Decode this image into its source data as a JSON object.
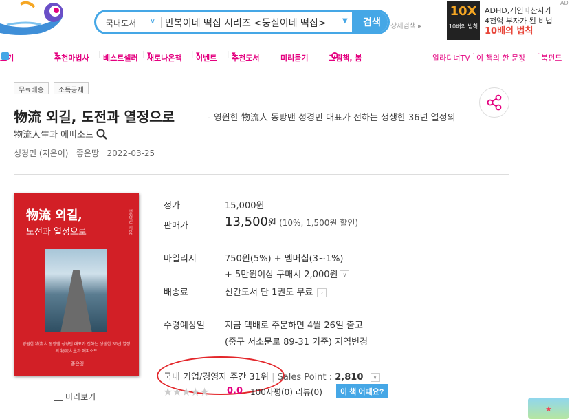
{
  "header": {
    "search": {
      "category": "국내도서",
      "query": "만복이네 떡집 시리즈 <둥실이네 떡집>",
      "button_label": "검색",
      "advanced_label": "상세검색"
    },
    "ad": {
      "mark": "AD",
      "image_title": "10X",
      "image_caption": "10배의 법칙",
      "line1": "ADHD,개인파산자가",
      "line2": "4천억 부자가 된 비법",
      "line3": "10배의 법칙"
    }
  },
  "nav": {
    "items": [
      "보기",
      "추천마법사",
      "베스트셀러",
      "새로나온책",
      "이벤트",
      "추천도서",
      "미리듣기",
      "그림책, 봄"
    ],
    "right": [
      "알라디너TV",
      "이 책의 한 문장",
      "북펀드"
    ]
  },
  "tags": [
    "무료배송",
    "소득공제"
  ],
  "book": {
    "title": "物流 외길, 도전과 열정으로",
    "subtitle": "- 영원한 物流人 동방맨 성경민 대표가 전하는 생생한 36년 열정의",
    "subtitle2": "物流人生과 에피소드",
    "author": "성경민 (지은이)",
    "publisher": "좋은땅",
    "date": "2022-03-25",
    "cover": {
      "title": "物流 외길,",
      "subtitle": "도전과 열정으로",
      "author": "성경민 지음",
      "desc": "영원한 物流人 동방맨 성경민 대표가 전하는 생생한 36년 열정의 物流人生과 에피소드",
      "publisher": "좋은땅"
    },
    "preview_label": "미리보기"
  },
  "info": {
    "list_price_label": "정가",
    "list_price": "15,000원",
    "sale_price_label": "판매가",
    "sale_price": "13,500",
    "sale_unit": "원",
    "sale_discount": "(10%, 1,500원 할인)",
    "mileage_label": "마일리지",
    "mileage_line1": "750원(5%) + 멤버십(3~1%)",
    "mileage_line2": "+ 5만원이상 구매시 2,000원",
    "shipping_label": "배송료",
    "shipping": "신간도서 단 1권도 무료",
    "delivery_label": "수령예상일",
    "delivery_line1": "지금 택배로 주문하면 4월 26일 출고",
    "delivery_line2": "(중구 서소문로 89-31 기준) 지역변경",
    "rank": "국내 기업/경영자 주간 31위",
    "sales_point_label": "Sales Point :",
    "sales_point": "2,810",
    "rating": "0.0",
    "review_text": "100자평(0)   리뷰(0)",
    "how_button": "이 책 어때요?"
  },
  "colors": {
    "accent": "#45a7e6",
    "pink": "#e4007f",
    "cover": "#d21f26",
    "circle": "#e3262a"
  }
}
